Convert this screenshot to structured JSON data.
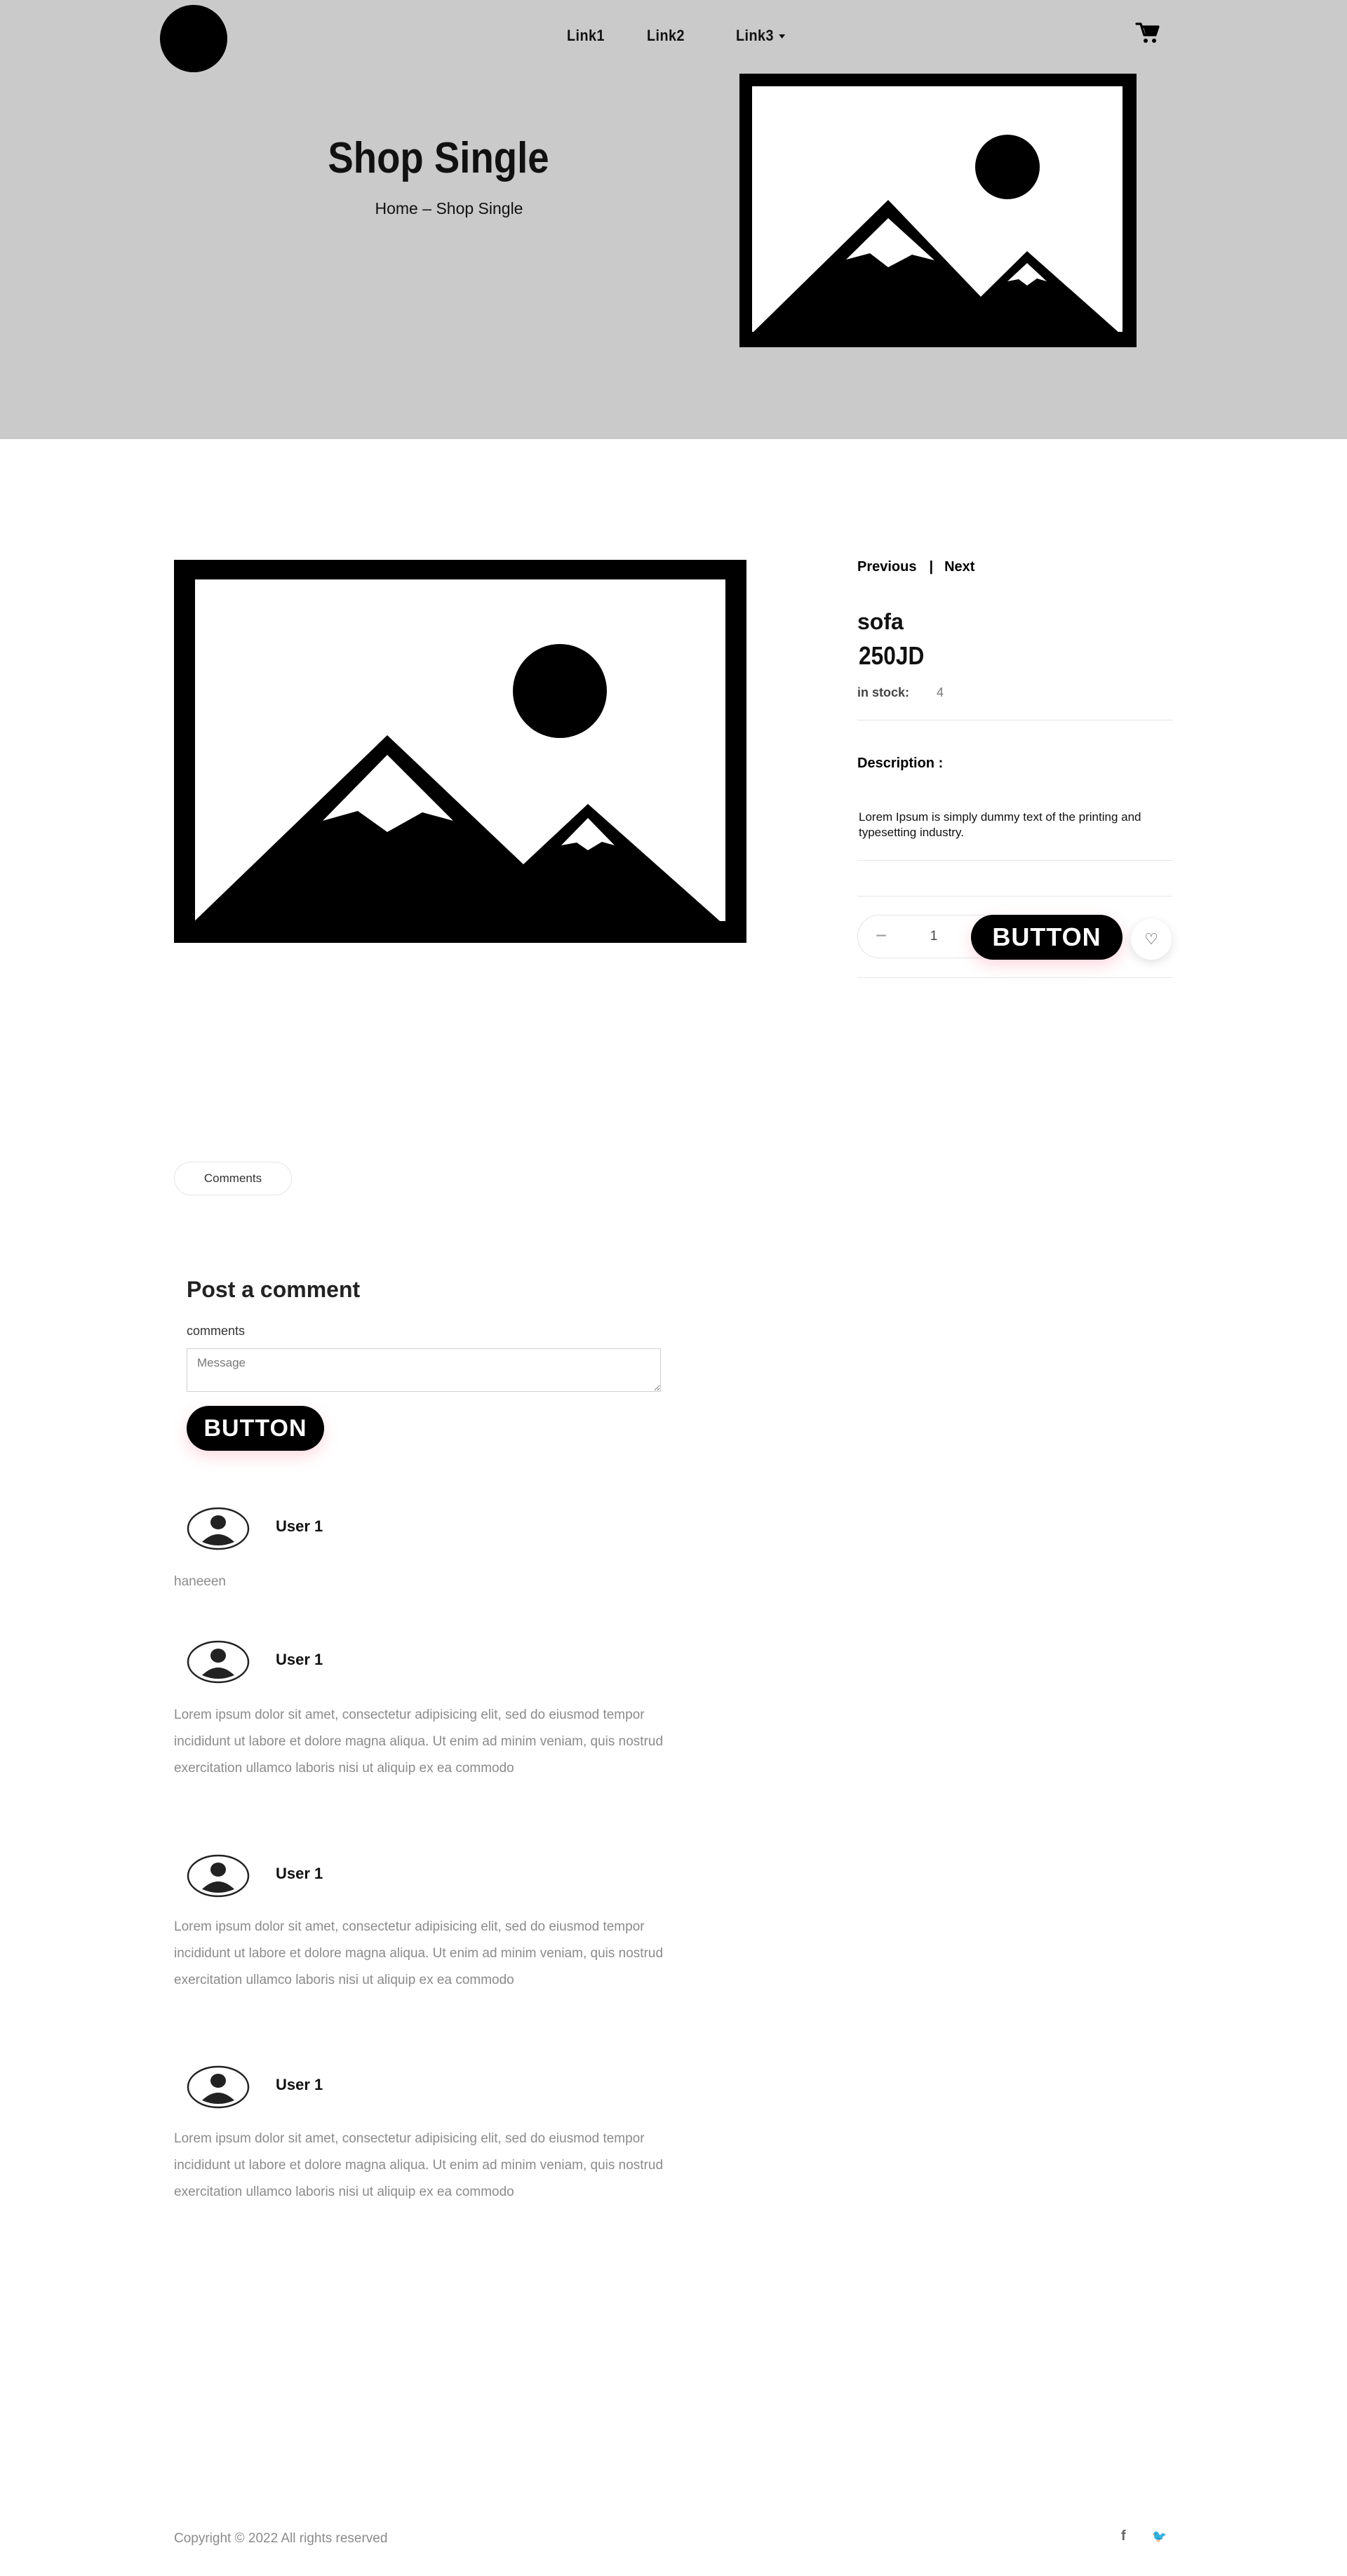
{
  "nav": {
    "links": [
      "Link1",
      "Link2",
      "Link3"
    ]
  },
  "hero": {
    "title": "Shop Single",
    "breadcrumb": {
      "home": "Home",
      "separator": "–",
      "current": "Shop Single"
    }
  },
  "product": {
    "pager": {
      "previous": "Previous",
      "separator": "|",
      "next": "Next"
    },
    "name": "sofa",
    "price": "250JD",
    "stock_label": "in stock:",
    "stock_value": "4",
    "description_label": "Description :",
    "description": "Lorem Ipsum is simply dummy text of the printing and typesetting industry.",
    "quantity": "1",
    "cart_button": "BUTTON",
    "icons": {
      "minus": "minus-icon",
      "plus": "plus-icon",
      "wishlist": "heart-icon"
    }
  },
  "tabs": {
    "comments": "Comments"
  },
  "comment_form": {
    "title": "Post a comment",
    "label": "comments",
    "placeholder": "Message",
    "submit": "BUTTON"
  },
  "comments": [
    {
      "user": "User 1",
      "text": "haneeen"
    },
    {
      "user": "User 1",
      "text": "Lorem ipsum dolor sit amet, consectetur adipisicing elit, sed do eiusmod tempor incididunt ut labore et dolore magna aliqua. Ut enim ad minim veniam, quis nostrud exercitation ullamco laboris nisi ut aliquip ex ea commodo"
    },
    {
      "user": "User 1",
      "text": "Lorem ipsum dolor sit amet, consectetur adipisicing elit, sed do eiusmod tempor incididunt ut labore et dolore magna aliqua. Ut enim ad minim veniam, quis nostrud exercitation ullamco laboris nisi ut aliquip ex ea commodo"
    },
    {
      "user": "User 1",
      "text": "Lorem ipsum dolor sit amet, consectetur adipisicing elit, sed do eiusmod tempor incididunt ut labore et dolore magna aliqua. Ut enim ad minim veniam, quis nostrud exercitation ullamco laboris nisi ut aliquip ex ea commodo"
    }
  ],
  "footer": {
    "copyright": "Copyright © 2022 All rights reserved",
    "social": {
      "facebook": "f",
      "twitter": "🐦"
    }
  },
  "colors": {
    "hero_bg": "#cacaca",
    "button": "#000000",
    "muted_text": "#8b8b8b"
  }
}
